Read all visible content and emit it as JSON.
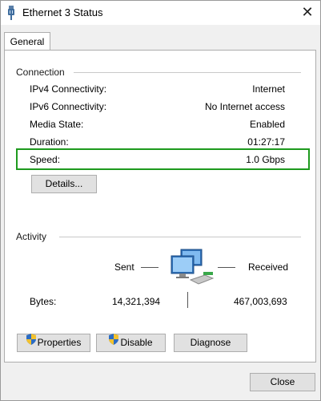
{
  "window": {
    "title": "Ethernet 3 Status",
    "close_glyph": "✕",
    "title_icon": "ethernet-adapter-icon"
  },
  "tabs": [
    {
      "label": "General",
      "selected": true
    }
  ],
  "connection": {
    "group_label": "Connection",
    "rows": [
      {
        "label": "IPv4 Connectivity:",
        "value": "Internet"
      },
      {
        "label": "IPv6 Connectivity:",
        "value": "No Internet access"
      },
      {
        "label": "Media State:",
        "value": "Enabled"
      },
      {
        "label": "Duration:",
        "value": "01:27:17"
      },
      {
        "label": "Speed:",
        "value": "1.0 Gbps"
      }
    ],
    "highlight_color": "#1e9a1e",
    "details_button": "Details..."
  },
  "activity": {
    "group_label": "Activity",
    "sent_label": "Sent",
    "received_label": "Received",
    "bytes_label": "Bytes:",
    "sent_bytes": "14,321,394",
    "received_bytes": "467,003,693",
    "icon": "network-computers-icon"
  },
  "actions": {
    "properties": "Properties",
    "disable": "Disable",
    "diagnose": "Diagnose",
    "shield_icon": "uac-shield-icon"
  },
  "footer": {
    "close_button": "Close"
  }
}
